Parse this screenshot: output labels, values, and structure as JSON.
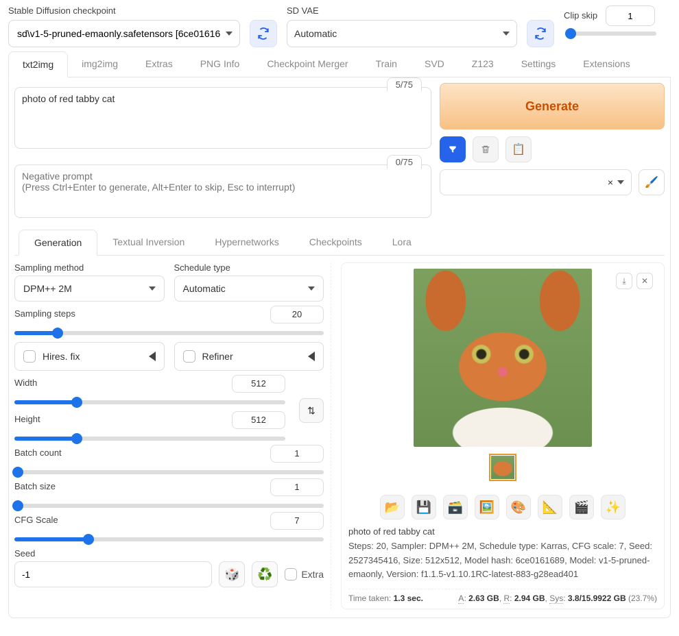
{
  "header": {
    "checkpoint_label": "Stable Diffusion checkpoint",
    "checkpoint_value": "sd\\v1-5-pruned-emaonly.safetensors [6ce01616",
    "vae_label": "SD VAE",
    "vae_value": "Automatic",
    "clip_label": "Clip skip",
    "clip_value": "1"
  },
  "tabs": [
    "txt2img",
    "img2img",
    "Extras",
    "PNG Info",
    "Checkpoint Merger",
    "Train",
    "SVD",
    "Z123",
    "Settings",
    "Extensions"
  ],
  "active_tab": "txt2img",
  "prompt": {
    "pos_value": "photo of red tabby cat",
    "pos_tokens": "5/75",
    "neg_placeholder": "Negative prompt\n(Press Ctrl+Enter to generate, Alt+Enter to skip, Esc to interrupt)",
    "neg_tokens": "0/75"
  },
  "generate_label": "Generate",
  "styles_x": "×",
  "sub_tabs": [
    "Generation",
    "Textual Inversion",
    "Hypernetworks",
    "Checkpoints",
    "Lora"
  ],
  "active_sub_tab": "Generation",
  "gen": {
    "sampling_method_label": "Sampling method",
    "sampling_method_value": "DPM++ 2M",
    "schedule_label": "Schedule type",
    "schedule_value": "Automatic",
    "steps_label": "Sampling steps",
    "steps_value": "20",
    "hires_label": "Hires. fix",
    "refiner_label": "Refiner",
    "width_label": "Width",
    "width_value": "512",
    "height_label": "Height",
    "height_value": "512",
    "batch_count_label": "Batch count",
    "batch_count_value": "1",
    "batch_size_label": "Batch size",
    "batch_size_value": "1",
    "cfg_label": "CFG Scale",
    "cfg_value": "7",
    "seed_label": "Seed",
    "seed_value": "-1",
    "extra_label": "Extra"
  },
  "result": {
    "prompt_echo": "photo of red tabby cat",
    "details": "Steps: 20, Sampler: DPM++ 2M, Schedule type: Karras, CFG scale: 7, Seed: 2527345416, Size: 512x512, Model hash: 6ce0161689, Model: v1-5-pruned-emaonly, Version: f1.1.5-v1.10.1RC-latest-883-g28ead401",
    "time_label": "Time taken:",
    "time_value": "1.3 sec.",
    "mem_a_label": "A",
    "mem_a": "2.63 GB",
    "mem_r_label": "R",
    "mem_r": "2.94 GB",
    "mem_sys_label": "Sys",
    "mem_sys": "3.8/15.9922 GB",
    "mem_sys_pct": "(23.7%)"
  }
}
